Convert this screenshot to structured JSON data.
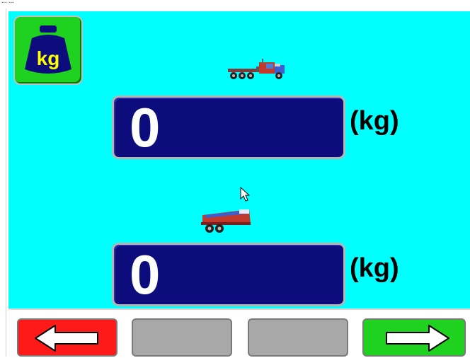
{
  "window": {
    "top_text": "... ..."
  },
  "weight_button": {
    "label": "kg",
    "icon": "weight-kg-icon",
    "color": "#1fd21f"
  },
  "readings": [
    {
      "vehicle_icon": "tractor-truck-icon",
      "value": "0",
      "unit": "(kg)"
    },
    {
      "vehicle_icon": "trailer-icon",
      "value": "0",
      "unit": "(kg)"
    }
  ],
  "navigation": {
    "back": {
      "icon": "arrow-left-icon",
      "color": "#ff1a1a"
    },
    "middle_left": {
      "color": "#a8a8a8"
    },
    "middle_right": {
      "color": "#a8a8a8"
    },
    "forward": {
      "icon": "arrow-right-icon",
      "color": "#1fd21f"
    }
  },
  "colors": {
    "background": "#00ffff",
    "display": "#0c0c7c"
  }
}
